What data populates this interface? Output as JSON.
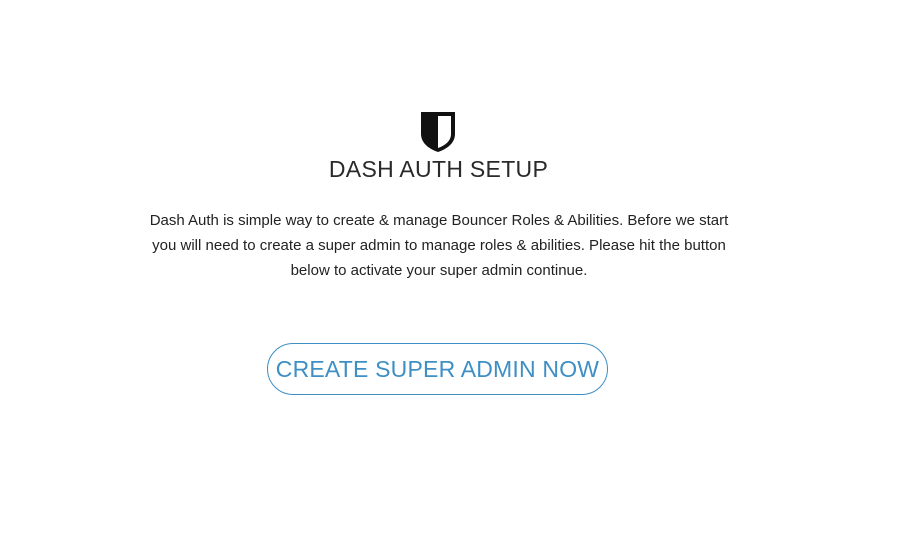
{
  "header": {
    "logo_icon": "shield-icon",
    "title": "DASH AUTH SETUP"
  },
  "main": {
    "description": "Dash Auth is simple way to create & manage Bouncer Roles & Abilities. Before we start you will need to create a super admin to manage roles & abilities. Please hit the button below to activate your super admin continue.",
    "cta_label": "CREATE SUPER ADMIN NOW"
  },
  "colors": {
    "accent": "#3d8fc4",
    "text": "#222222",
    "icon": "#111111"
  }
}
